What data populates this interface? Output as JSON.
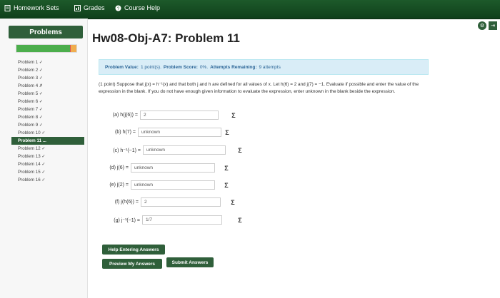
{
  "topbar": {
    "homework_sets": "Homework Sets",
    "grades": "Grades",
    "course_help": "Course Help"
  },
  "sidebar": {
    "heading": "Problems",
    "progress_fraction": 0.94,
    "items": [
      "Problem 1 ✓",
      "Problem 2 ✓",
      "Problem 3 ✓",
      "Problem 4 ✗",
      "Problem 5 ✓",
      "Problem 6 ✓",
      "Problem 7 ✓",
      "Problem 8 ✓",
      "Problem 9 ✓",
      "Problem 10 ✓",
      "Problem 11 ...",
      "Problem 12 ✓",
      "Problem 13 ✓",
      "Problem 14 ✓",
      "Problem 15 ✓",
      "Problem 16 ✓"
    ],
    "active_index": 10
  },
  "main": {
    "title": "Hw08-Obj-A7: Problem 11",
    "value_label": "Problem Value:",
    "value": "1 point(s).",
    "score_label": "Problem Score:",
    "score": "0%.",
    "attempts_label": "Attempts Remaining:",
    "attempts": "9 attempts",
    "intro": "(1 point) Suppose that j(x) = h⁻¹(x) and that both j and h are defined for all values of x. Let h(6) = 2 and j(7) = −1. Evaluate if possible and enter the value of the expression in the blank. If you do not have enough given information to evaluate the expression, enter unknown in the blank beside the expression.",
    "questions": [
      {
        "label": "(a) h(j(6)) =",
        "value": "2"
      },
      {
        "label": "(b) h(7) =",
        "value": "unknown"
      },
      {
        "label": "(c) h⁻¹(−1) =",
        "value": "unknown"
      },
      {
        "label": "(d) j(6) =",
        "value": "unknown"
      },
      {
        "label": "(e) j(2) =",
        "value": "unknown"
      },
      {
        "label": "(f) j(h(6)) =",
        "value": "2"
      },
      {
        "label": "(g) j⁻¹(−1) =",
        "value": "1/7"
      }
    ],
    "sigma_symbol": "Σ"
  },
  "buttons": {
    "help": "Help Entering Answers",
    "preview": "Preview My Answers",
    "submit": "Submit Answers"
  },
  "icons": {
    "gear": "⚙",
    "exit": "⇥"
  }
}
